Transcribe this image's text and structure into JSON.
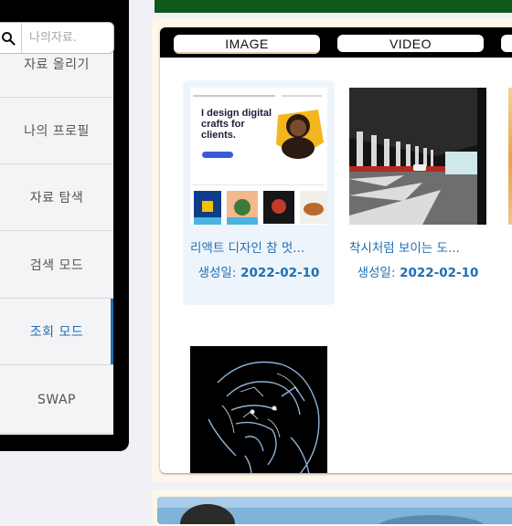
{
  "search": {
    "placeholder": "나의자료."
  },
  "sidebar": {
    "items": [
      {
        "label": "자료 올리기"
      },
      {
        "label": "나의 프로필"
      },
      {
        "label": "자료 탐색"
      },
      {
        "label": "검색 모드"
      },
      {
        "label": "조회 모드"
      },
      {
        "label": "SWAP"
      }
    ],
    "active_index": 4,
    "active_color": "#1f6fb5"
  },
  "viewer": {
    "tabs": [
      {
        "label": "IMAGE"
      },
      {
        "label": "VIDEO"
      },
      {
        "label": ""
      }
    ],
    "items": [
      {
        "title": "리액트 디자인 참 멋...",
        "date_label": "생성일:",
        "date": "2022-02-10",
        "thumb": {
          "headline": "I design digital crafts for clients."
        }
      },
      {
        "title": "착시처럼 보이는 도...",
        "date_label": "생성일:",
        "date": "2022-02-10"
      },
      {
        "title": "",
        "date_label": "",
        "date": ""
      },
      {
        "title": "",
        "date_label": "",
        "date": ""
      }
    ]
  },
  "colors": {
    "top_bar": "#0f5a1b",
    "link": "#1f6fb5",
    "card_bg": "#fdf6e9"
  }
}
